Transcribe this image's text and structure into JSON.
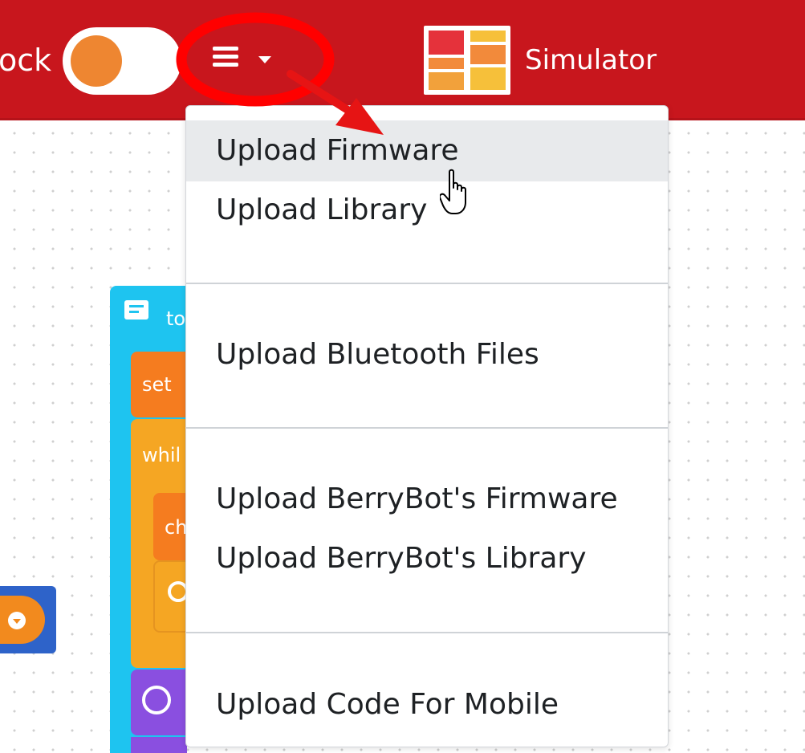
{
  "header": {
    "mode_label": "ock",
    "simulator_label": "Simulator",
    "menu_icon": "hamburger-menu-icon",
    "menu_caret_icon": "caret-down-icon",
    "simulator_icon": "simulator-grid-icon"
  },
  "dropdown": {
    "items": [
      {
        "label": "Upload Firmware"
      },
      {
        "label": "Upload Library"
      },
      {
        "label": "Upload Bluetooth Files"
      },
      {
        "label": "Upload BerryBot's Firmware"
      },
      {
        "label": "Upload BerryBot's Library"
      },
      {
        "label": "Upload Code For Mobile"
      }
    ],
    "hovered_index": 0
  },
  "workspace": {
    "block_labels": [
      "to",
      "set",
      "whil",
      "ch"
    ]
  },
  "colors": {
    "header": "#c8161d",
    "toggle_knob": "#ee8631",
    "block_cyan": "#1ec4f0",
    "block_orange": "#f57c1f",
    "block_yellow": "#f5a623",
    "block_purple": "#8a4fe0",
    "block_blue": "#2e63c9",
    "annotation_red": "#ff0000"
  }
}
